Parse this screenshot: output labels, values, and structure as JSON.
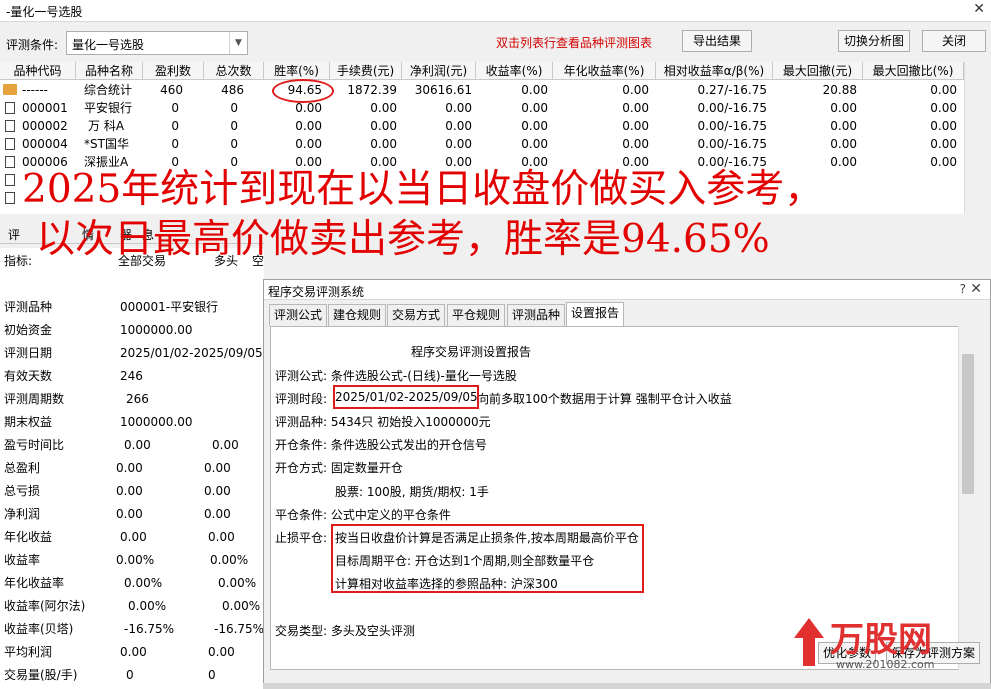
{
  "window": {
    "title": "-量化一号选股",
    "close": "✕"
  },
  "toolbar": {
    "condition_label": "评测条件:",
    "condition_value": "量化一号选股",
    "hint": "双击列表行查看品种评测图表",
    "export_btn": "导出结果",
    "switch_btn": "切换分析图",
    "close_btn": "关闭"
  },
  "table": {
    "headers": [
      "品种代码",
      "品种名称",
      "盈利数",
      "总次数",
      "胜率(%)",
      "手续费(元)",
      "净利润(元)",
      "收益率(%)",
      "年化收益率(%)",
      "相对收益率α/β(%)",
      "最大回撤(元)",
      "最大回撤比(%)"
    ],
    "rows": [
      [
        "------",
        "综合统计",
        "460",
        "486",
        "94.65",
        "1872.39",
        "30616.61",
        "0.00",
        "0.00",
        "0.27/-16.75",
        "20.88",
        "0.00"
      ],
      [
        "000001",
        "平安银行",
        "0",
        "0",
        "0.00",
        "0.00",
        "0.00",
        "0.00",
        "0.00",
        "0.00/-16.75",
        "0.00",
        "0.00"
      ],
      [
        "000002",
        "万 科A",
        "0",
        "0",
        "0.00",
        "0.00",
        "0.00",
        "0.00",
        "0.00",
        "0.00/-16.75",
        "0.00",
        "0.00"
      ],
      [
        "000004",
        "*ST国华",
        "0",
        "0",
        "0.00",
        "0.00",
        "0.00",
        "0.00",
        "0.00",
        "0.00/-16.75",
        "0.00",
        "0.00"
      ],
      [
        "000006",
        "深振业A",
        "0",
        "0",
        "0.00",
        "0.00",
        "0.00",
        "0.00",
        "0.00",
        "0.00/-16.75",
        "0.00",
        "0.00"
      ]
    ]
  },
  "caption": {
    "line1": "2025年统计到现在以当日收盘价做买入参考，",
    "line2": "以次日最高价做卖出参考，胜率是94.65%"
  },
  "left_tabs": [
    "评",
    "情",
    "器",
    "息"
  ],
  "left_header": [
    "指标:",
    "全部交易",
    "多头",
    "空头"
  ],
  "stats": [
    [
      "评测品种",
      "000001-平安银行",
      ""
    ],
    [
      "初始资金",
      "1000000.00",
      ""
    ],
    [
      "评测日期",
      "2025/01/02-2025/09/05",
      ""
    ],
    [
      "有效天数",
      "246",
      ""
    ],
    [
      "评测周期数",
      "266",
      ""
    ],
    [
      "期末权益",
      "1000000.00",
      ""
    ],
    [
      "盈亏时间比",
      "0.00",
      "0.00"
    ],
    [
      "总盈利",
      "0.00",
      "0.00"
    ],
    [
      "总亏损",
      "0.00",
      "0.00"
    ],
    [
      "净利润",
      "0.00",
      "0.00"
    ],
    [
      "年化收益",
      "0.00",
      "0.00"
    ],
    [
      "收益率",
      "0.00%",
      "0.00%"
    ],
    [
      "年化收益率",
      "0.00%",
      "0.00%"
    ],
    [
      "收益率(阿尔法)",
      "0.00%",
      "0.00%"
    ],
    [
      "收益率(贝塔)",
      "-16.75%",
      "-16.75%"
    ],
    [
      "平均利润",
      "0.00",
      "0.00"
    ],
    [
      "交易量(股/手)",
      "0",
      "0"
    ]
  ],
  "dialog": {
    "title": "程序交易评测系统",
    "help": "?",
    "close": "✕",
    "tabs": [
      "评测公式",
      "建仓规则",
      "交易方式",
      "平仓规则",
      "评测品种",
      "设置报告"
    ],
    "report_title": "程序交易评测设置报告",
    "lines": {
      "formula": "评测公式: 条件选股公式-(日线)-量化一号选股",
      "period_label": "评测时段:",
      "period_value": "2025/01/02-2025/09/05",
      "period_rest": "向前多取100个数据用于计算 强制平仓计入收益",
      "stocks": "评测品种: 5434只 初始投入1000000元",
      "open_cond": "开仓条件: 条件选股公式发出的开仓信号",
      "open_mode": "开仓方式: 固定数量开仓",
      "lots": "股票: 100股, 期货/期权: 1手",
      "close_cond": "平仓条件: 公式中定义的平仓条件",
      "stop_label": "止损平仓:",
      "stop1": "按当日收盘价计算是否满足止损条件,按本周期最高价平仓",
      "stop2": "目标周期平仓: 开仓达到1个周期,则全部数量平仓",
      "stop3": "计算相对收益率选择的参照品种: 沪深300",
      "trade_type": "交易类型: 多头及空头评测"
    },
    "buttons": [
      "优化参数",
      "保存为评测方案"
    ]
  },
  "logo": {
    "name": "万股网",
    "url": "www.201082.com"
  }
}
